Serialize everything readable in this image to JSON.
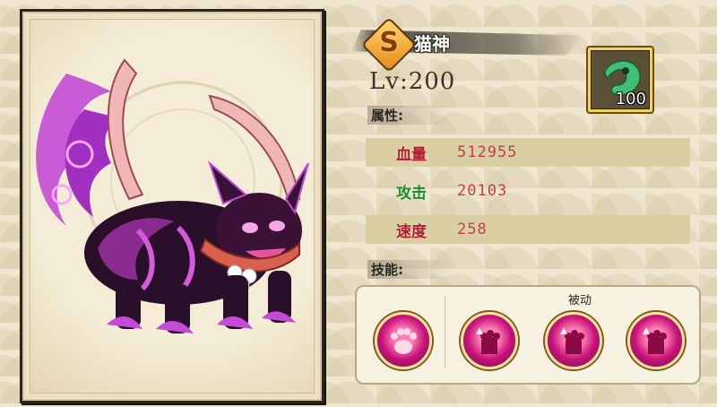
{
  "character": {
    "rank": "S",
    "name": "猫神",
    "level_text": "Lv:200"
  },
  "attributes": {
    "title": "属性:",
    "stats": [
      {
        "label": "血量",
        "value": "512955",
        "color": "#b01e2e"
      },
      {
        "label": "攻击",
        "value": "20103",
        "color": "#1e8a2e"
      },
      {
        "label": "速度",
        "value": "258",
        "color": "#b01e2e"
      }
    ]
  },
  "item": {
    "icon": "green-jade-icon",
    "count": "100"
  },
  "skills": {
    "title": "技能:",
    "passive_label": "被动",
    "active": {
      "icon": "paw-icon"
    },
    "passive": [
      {
        "icon": "claw-up-icon"
      },
      {
        "icon": "claw-up-icon"
      },
      {
        "icon": "claw-up-icon"
      }
    ]
  },
  "colors": {
    "accent": "#c2404f",
    "skill_pink": "#c8147a",
    "frame": "#2b241d"
  }
}
